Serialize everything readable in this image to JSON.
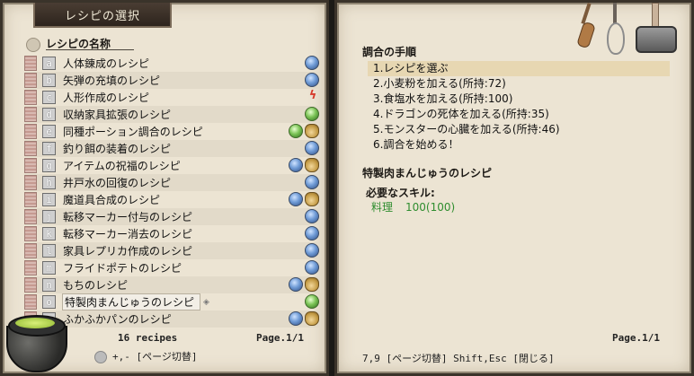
{
  "window": {
    "title": "レシピの選択"
  },
  "left": {
    "header": "レシピの名称",
    "recipes": [
      {
        "key": "a",
        "name": "人体錬成のレシピ",
        "icons": [
          "orb-blue-icon"
        ]
      },
      {
        "key": "b",
        "name": "矢弾の充填のレシピ",
        "icons": [
          "orb-blue-icon"
        ]
      },
      {
        "key": "c",
        "name": "人形作成のレシピ",
        "icons": [
          "lightning-icon"
        ]
      },
      {
        "key": "d",
        "name": "収納家具拡張のレシピ",
        "icons": [
          "orb-green-icon"
        ]
      },
      {
        "key": "e",
        "name": "同種ポーション調合のレシピ",
        "icons": [
          "orb-green-icon",
          "money-bag-icon"
        ]
      },
      {
        "key": "f",
        "name": "釣り餌の装着のレシピ",
        "icons": [
          "orb-blue-icon"
        ]
      },
      {
        "key": "g",
        "name": "アイテムの祝福のレシピ",
        "icons": [
          "orb-blue-icon",
          "money-bag-icon"
        ]
      },
      {
        "key": "h",
        "name": "井戸水の回復のレシピ",
        "icons": [
          "orb-blue-icon"
        ]
      },
      {
        "key": "i",
        "name": "魔道具合成のレシピ",
        "icons": [
          "orb-blue-icon",
          "money-bag-icon"
        ]
      },
      {
        "key": "j",
        "name": "転移マーカー付与のレシピ",
        "icons": [
          "orb-blue-icon"
        ]
      },
      {
        "key": "k",
        "name": "転移マーカー消去のレシピ",
        "icons": [
          "orb-blue-icon"
        ]
      },
      {
        "key": "l",
        "name": "家具レプリカ作成のレシピ",
        "icons": [
          "orb-blue-icon"
        ]
      },
      {
        "key": "m",
        "name": "フライドポテトのレシピ",
        "icons": [
          "orb-blue-icon"
        ]
      },
      {
        "key": "n",
        "name": "もちのレシピ",
        "icons": [
          "orb-blue-icon",
          "money-bag-icon"
        ]
      },
      {
        "key": "o",
        "name": "特製肉まんじゅうのレシピ",
        "icons": [
          "orb-green-icon"
        ],
        "selected": true
      },
      {
        "key": "",
        "name": "ふかふかパンのレシピ",
        "icons": [
          "orb-blue-icon",
          "money-bag-icon"
        ]
      }
    ],
    "count_text": "16 recipes",
    "page_text": "Page.1/1",
    "help_text": "+,- [ページ切替]"
  },
  "right": {
    "steps_title": "調合の手順",
    "steps": [
      "1.レシピを選ぶ",
      "2.小麦粉を加える(所持:72)",
      "3.食塩水を加える(所持:100)",
      "4.ドラゴンの死体を加える(所持:35)",
      "5.モンスターの心臓を加える(所持:46)",
      "6.調合を始める！"
    ],
    "active_step": 0,
    "recipe_title": "特製肉まんじゅうのレシピ",
    "skills_label": "必要なスキル:",
    "skill_name": "料理",
    "skill_value": "100(100)",
    "page_text": "Page.1/1",
    "help_text": "7,9 [ページ切替]  Shift,Esc [閉じる]"
  },
  "colors": {
    "panel": "#ece4d3",
    "active_step": "#e7d7b2",
    "skill": "#2f8d2f",
    "orb_blue": "#6f9bd6",
    "orb_green": "#7cc457",
    "bolt": "#d6392a"
  }
}
